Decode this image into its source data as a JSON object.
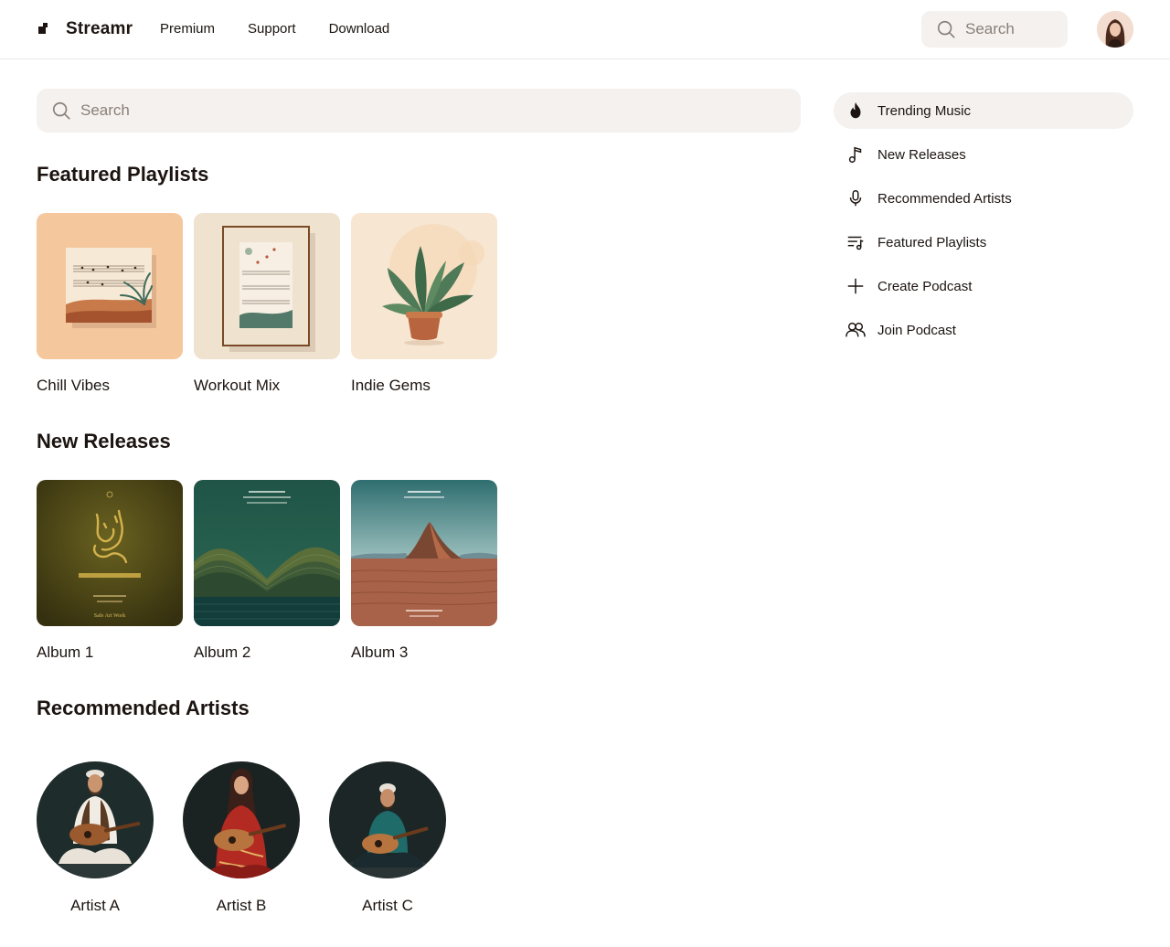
{
  "app": {
    "name": "Streamr"
  },
  "nav": {
    "links": [
      "Premium",
      "Support",
      "Download"
    ]
  },
  "top_search": {
    "placeholder": "Search"
  },
  "main_search": {
    "placeholder": "Search"
  },
  "sections": {
    "featured": {
      "title": "Featured Playlists",
      "items": [
        "Chill Vibes",
        "Workout Mix",
        "Indie Gems"
      ]
    },
    "releases": {
      "title": "New Releases",
      "items": [
        "Album 1",
        "Album 2",
        "Album 3"
      ]
    },
    "artists": {
      "title": "Recommended Artists",
      "items": [
        "Artist A",
        "Artist B",
        "Artist C"
      ]
    }
  },
  "sidebar": {
    "items": [
      {
        "label": "Trending Music",
        "icon": "flame-icon",
        "active": true
      },
      {
        "label": "New Releases",
        "icon": "music-note-icon"
      },
      {
        "label": "Recommended Artists",
        "icon": "microphone-icon"
      },
      {
        "label": "Featured Playlists",
        "icon": "playlist-icon"
      },
      {
        "label": "Create Podcast",
        "icon": "plus-icon"
      },
      {
        "label": "Join Podcast",
        "icon": "users-icon"
      }
    ]
  },
  "album_art_text": {
    "album1": "Safe Art Work"
  },
  "colors": {
    "accent_bg": "#f4f1ee",
    "text": "#1c1410",
    "muted": "#8a7f78"
  }
}
